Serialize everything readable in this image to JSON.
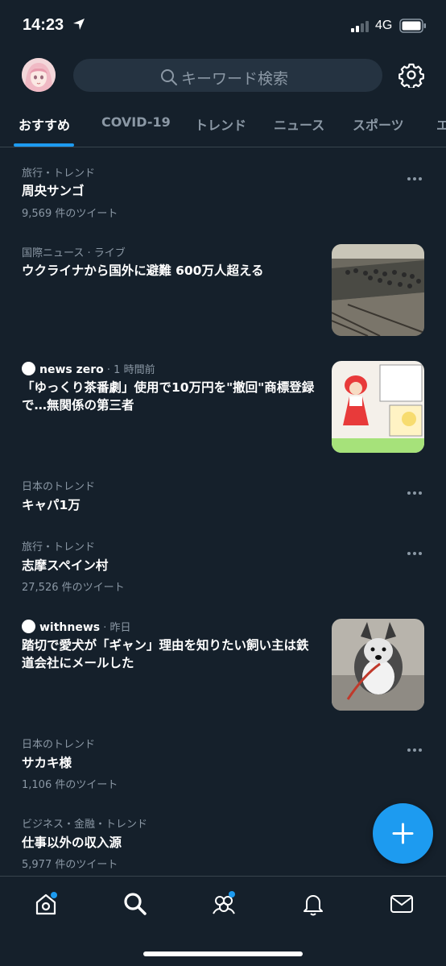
{
  "status_bar": {
    "time": "14:23",
    "network": "4G"
  },
  "search": {
    "placeholder": "キーワード検索"
  },
  "tabs": [
    {
      "label": "おすすめ",
      "active": true
    },
    {
      "label": "COVID-19"
    },
    {
      "label": "トレンド"
    },
    {
      "label": "ニュース"
    },
    {
      "label": "スポーツ"
    },
    {
      "label": "エ"
    }
  ],
  "feed": [
    {
      "meta": "旅行・トレンド",
      "title": "周央サンゴ",
      "count": "9,569 件のツイート"
    },
    {
      "meta_category": "国際ニュース",
      "meta_suffix": " · ライブ",
      "title": "ウクライナから国外に避難 600万人超える",
      "thumb": "train-station-crowd"
    },
    {
      "source": "news zero",
      "time": " · 1 時間前",
      "title": "「ゆっくり茶番劇」使用で10万円を\"撤回\"商標登録で…無関係の第三者",
      "thumb": "yukkuri-illustration"
    },
    {
      "meta": "日本のトレンド",
      "title": "キャパ1万"
    },
    {
      "meta": "旅行・トレンド",
      "title": "志摩スペイン村",
      "count": "27,526 件のツイート"
    },
    {
      "source": "withnews",
      "time": " · 昨日",
      "title": "踏切で愛犬が「ギャン」理由を知りたい飼い主は鉄道会社にメールした",
      "thumb": "husky-dog"
    },
    {
      "meta": "日本のトレンド",
      "title": "サカキ様",
      "count": "1,106 件のツイート"
    },
    {
      "meta": "ビジネス・金融・トレンド",
      "title": "仕事以外の収入源",
      "count": "5,977 件のツイート"
    }
  ],
  "colors": {
    "background": "#15202b",
    "accent": "#1d9bf0",
    "secondary_text": "#8b98a5",
    "search_bg": "#253341"
  }
}
